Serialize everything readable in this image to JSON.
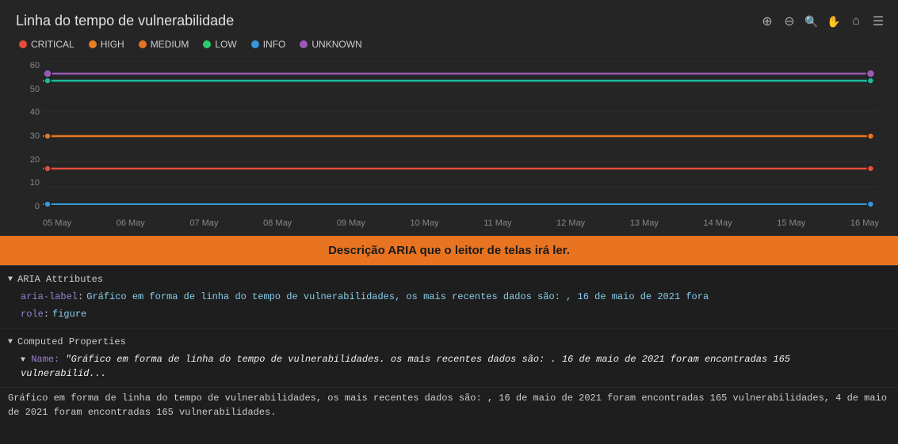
{
  "chart": {
    "title": "Linha do tempo de vulnerabilidade",
    "legend": [
      {
        "id": "critical",
        "label": "CRITICAL",
        "color": "#e74c3c"
      },
      {
        "id": "high",
        "label": "HIGH",
        "color": "#e67e22"
      },
      {
        "id": "medium",
        "label": "MEDIUM",
        "color": "#e87422"
      },
      {
        "id": "low",
        "label": "LOW",
        "color": "#2ecc71"
      },
      {
        "id": "info",
        "label": "INFO",
        "color": "#3498db"
      },
      {
        "id": "unknown",
        "label": "UNKNOWN",
        "color": "#9b59b6"
      }
    ],
    "yAxis": [
      "60",
      "50",
      "40",
      "30",
      "20",
      "10",
      "0"
    ],
    "xAxis": [
      "05 May",
      "06 May",
      "07 May",
      "08 May",
      "09 May",
      "10 May",
      "11 May",
      "12 May",
      "13 May",
      "14 May",
      "15 May",
      "16 May"
    ],
    "toolbar": {
      "zoomIn": "⊕",
      "zoomOut": "⊖",
      "magnify": "🔍",
      "pan": "✋",
      "home": "⌂",
      "menu": "☰"
    },
    "lines": [
      {
        "id": "purple",
        "color": "#9b59b6",
        "y": 55,
        "endDot": true
      },
      {
        "id": "teal",
        "color": "#1abc9c",
        "y": 52,
        "endDot": true
      },
      {
        "id": "orange",
        "color": "#e87422",
        "y": 30,
        "endDot": true
      },
      {
        "id": "red",
        "color": "#e74c3c",
        "y": 17,
        "endDot": true
      },
      {
        "id": "blue",
        "color": "#3498db",
        "y": 3,
        "endDot": true
      }
    ]
  },
  "ariaBar": {
    "text": "Descrição ARIA que o leitor de telas irá ler."
  },
  "devtools": {
    "aria": {
      "sectionLabel": "ARIA Attributes",
      "attributes": [
        {
          "name": "aria-label",
          "value": "Gráfico em forma de linha do tempo de vulnerabilidades, os mais recentes dados são: , 16 de maio de 2021 fora"
        },
        {
          "name": "role",
          "value": "figure"
        }
      ]
    },
    "computed": {
      "sectionLabel": "Computed Properties",
      "properties": [
        {
          "name": "Name",
          "value": "\"Gráfico em forma de linha do tempo de vulnerabilidades. os mais recentes dados são: . 16 de maio de 2021 foram encontradas 165 vulnerabilid..."
        }
      ]
    },
    "bottomText": "Gráfico em forma de linha do tempo de vulnerabilidades, os mais recentes dados são: , 16 de maio de 2021 foram encontradas 165 vulnerabilidades, 4 de maio de 2021 foram encontradas 165 vulnerabilidades."
  }
}
